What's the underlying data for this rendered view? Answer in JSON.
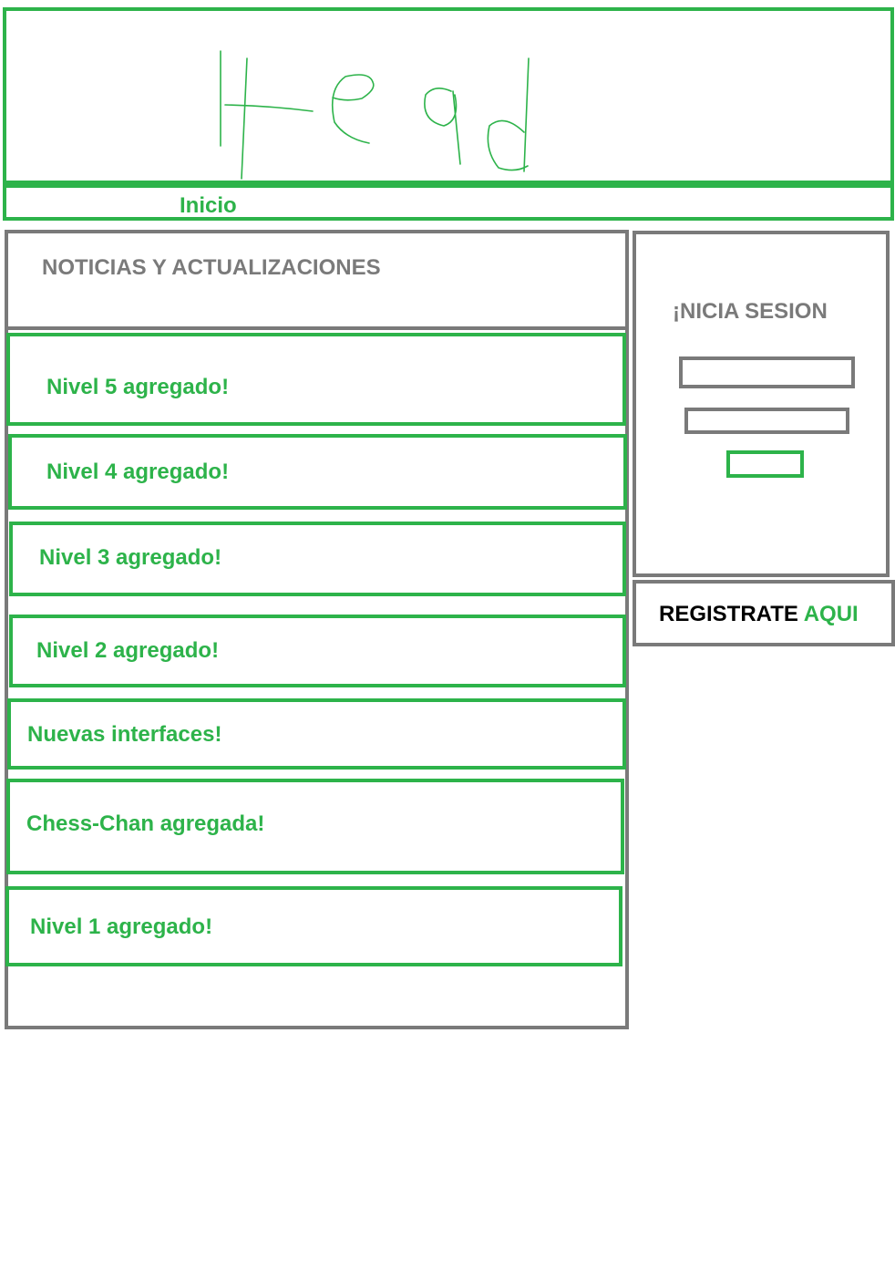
{
  "nav": {
    "inicio": "Inicio"
  },
  "news": {
    "title": "NOTICIAS Y ACTUALIZACIONES",
    "items": [
      "Nivel 5 agregado!",
      "Nivel 4 agregado!",
      "Nivel 3 agregado!",
      "Nivel 2 agregado!",
      "Nuevas interfaces!",
      "Chess-Chan agregada!",
      "Nivel 1 agregado!"
    ]
  },
  "login": {
    "title": "¡NICIA SESION",
    "username_value": "",
    "password_value": "",
    "submit_label": ""
  },
  "register": {
    "prefix": "REGISTRATE",
    "link": "AQUI"
  },
  "colors": {
    "accent": "#2db34a",
    "frame": "#7a7a7a"
  }
}
